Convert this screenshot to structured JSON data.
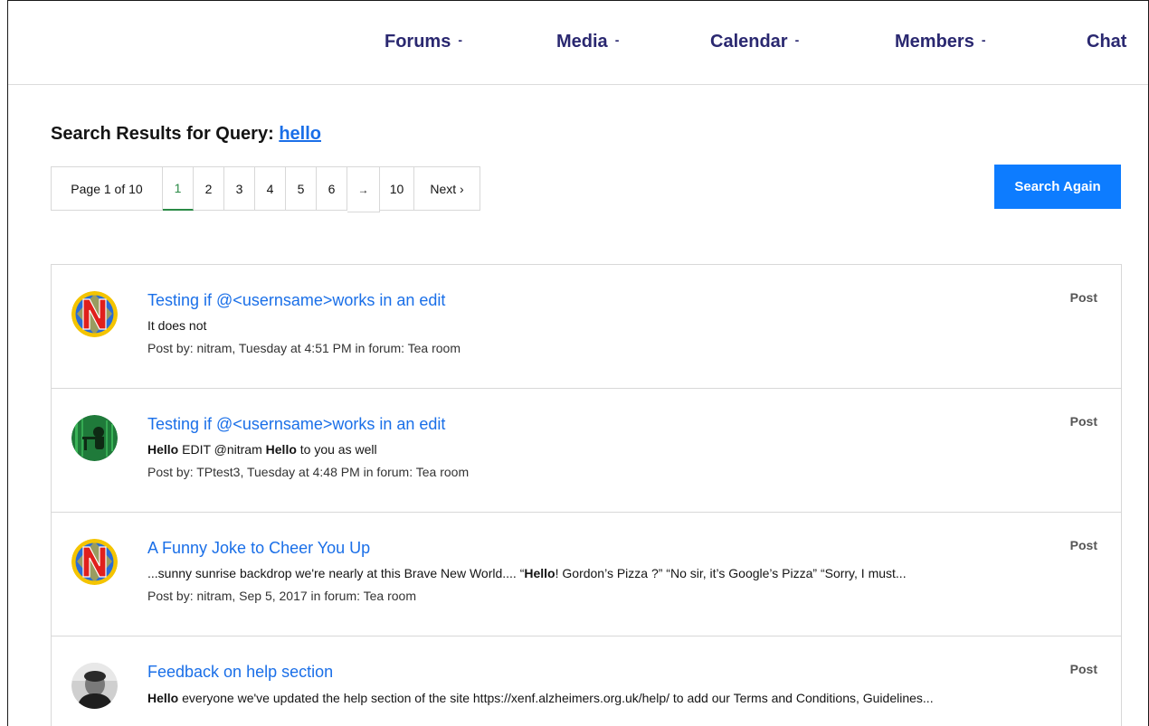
{
  "nav": {
    "forums": "Forums",
    "media": "Media",
    "calendar": "Calendar",
    "members": "Members",
    "chat": "Chat",
    "caret": "-"
  },
  "search": {
    "title_prefix": "Search Results for Query: ",
    "query": "hello",
    "search_again_label": "Search Again"
  },
  "pagination": {
    "page_label": "Page 1 of 10",
    "pages": [
      "1",
      "2",
      "3",
      "4",
      "5",
      "6"
    ],
    "active_page": "1",
    "jump": "→",
    "last_page": "10",
    "next_label": "Next ›"
  },
  "results": [
    {
      "title": "Testing if @<usernsame>works in an edit",
      "snippet": [
        "",
        "It does not"
      ],
      "meta": "Post by: nitram, Tuesday at 4:51 PM in forum: Tea room",
      "type": "Post",
      "avatar": "n-logo"
    },
    {
      "title": "Testing if @<usernsame>works in an edit",
      "snippet_parts": [
        {
          "text": "Hello",
          "bold": true
        },
        {
          "text": " EDIT @nitram ",
          "bold": false
        },
        {
          "text": "Hello",
          "bold": true
        },
        {
          "text": " to you as well",
          "bold": false
        }
      ],
      "meta": "Post by: TPtest3, Tuesday at 4:48 PM in forum: Tea room",
      "type": "Post",
      "avatar": "green-matrix"
    },
    {
      "title": "A Funny Joke to Cheer You Up",
      "snippet_parts": [
        {
          "text": "...sunny sunrise backdrop we're nearly at this Brave New World.... “",
          "bold": false
        },
        {
          "text": "Hello",
          "bold": true
        },
        {
          "text": "! Gordon’s Pizza ?” “No sir, it’s Google’s Pizza” “Sorry, I must...",
          "bold": false
        }
      ],
      "meta": "Post by: nitram, Sep 5, 2017 in forum: Tea room",
      "type": "Post",
      "avatar": "n-logo"
    },
    {
      "title": "Feedback on help section",
      "snippet_parts": [
        {
          "text": "Hello",
          "bold": true
        },
        {
          "text": " everyone we've updated the help section of the site https://xenf.alzheimers.org.uk/help/ to add our Terms and Conditions, Guidelines...",
          "bold": false
        }
      ],
      "meta": "",
      "type": "Post",
      "avatar": "photo-person"
    }
  ],
  "colors": {
    "nav_text": "#2a2870",
    "link": "#1a6fe8",
    "button": "#0d7cff",
    "active_page": "#2a8a46"
  }
}
